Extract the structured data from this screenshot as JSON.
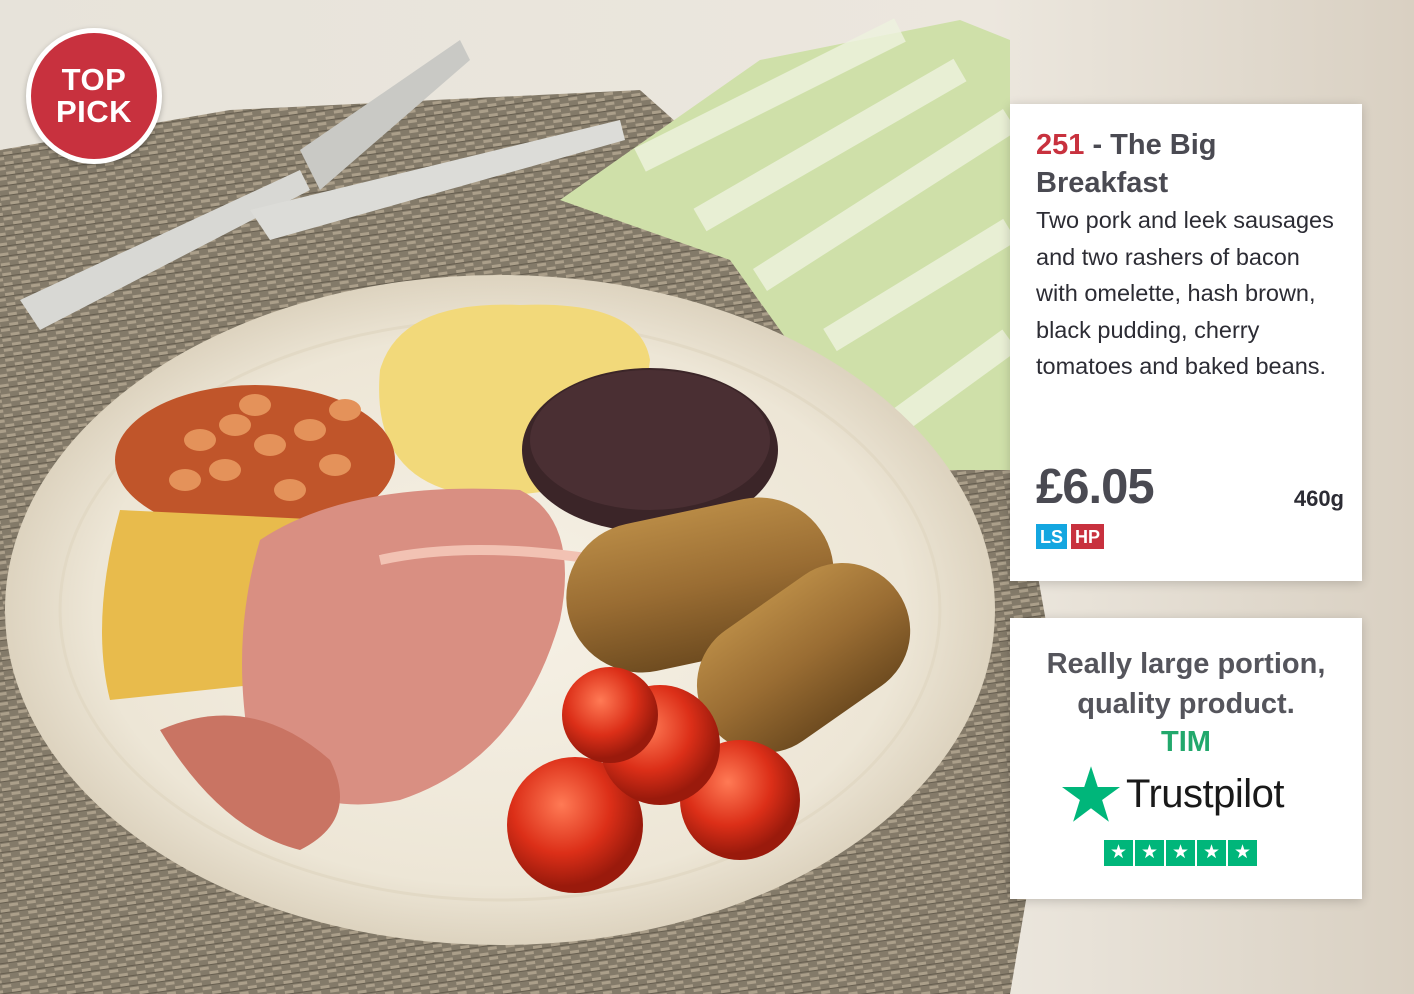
{
  "badge": {
    "line1": "TOP",
    "line2": "PICK"
  },
  "product": {
    "code": "251",
    "separator": " - ",
    "name": "The Big Breakfast",
    "description": "Two pork and leek sausages and two rashers of bacon with omelette, hash brown, black pudding, cherry tomatoes and baked beans.",
    "price": "£6.05",
    "weight": "460g",
    "tags": [
      "LS",
      "HP"
    ]
  },
  "review": {
    "quote": "Really large portion, quality product.",
    "author": "TIM",
    "brand": "Trustpilot",
    "rating_stars": 5
  },
  "colors": {
    "accent_red": "#c8313e",
    "trustpilot_green": "#00b67a",
    "ls_blue": "#14a6e0"
  }
}
